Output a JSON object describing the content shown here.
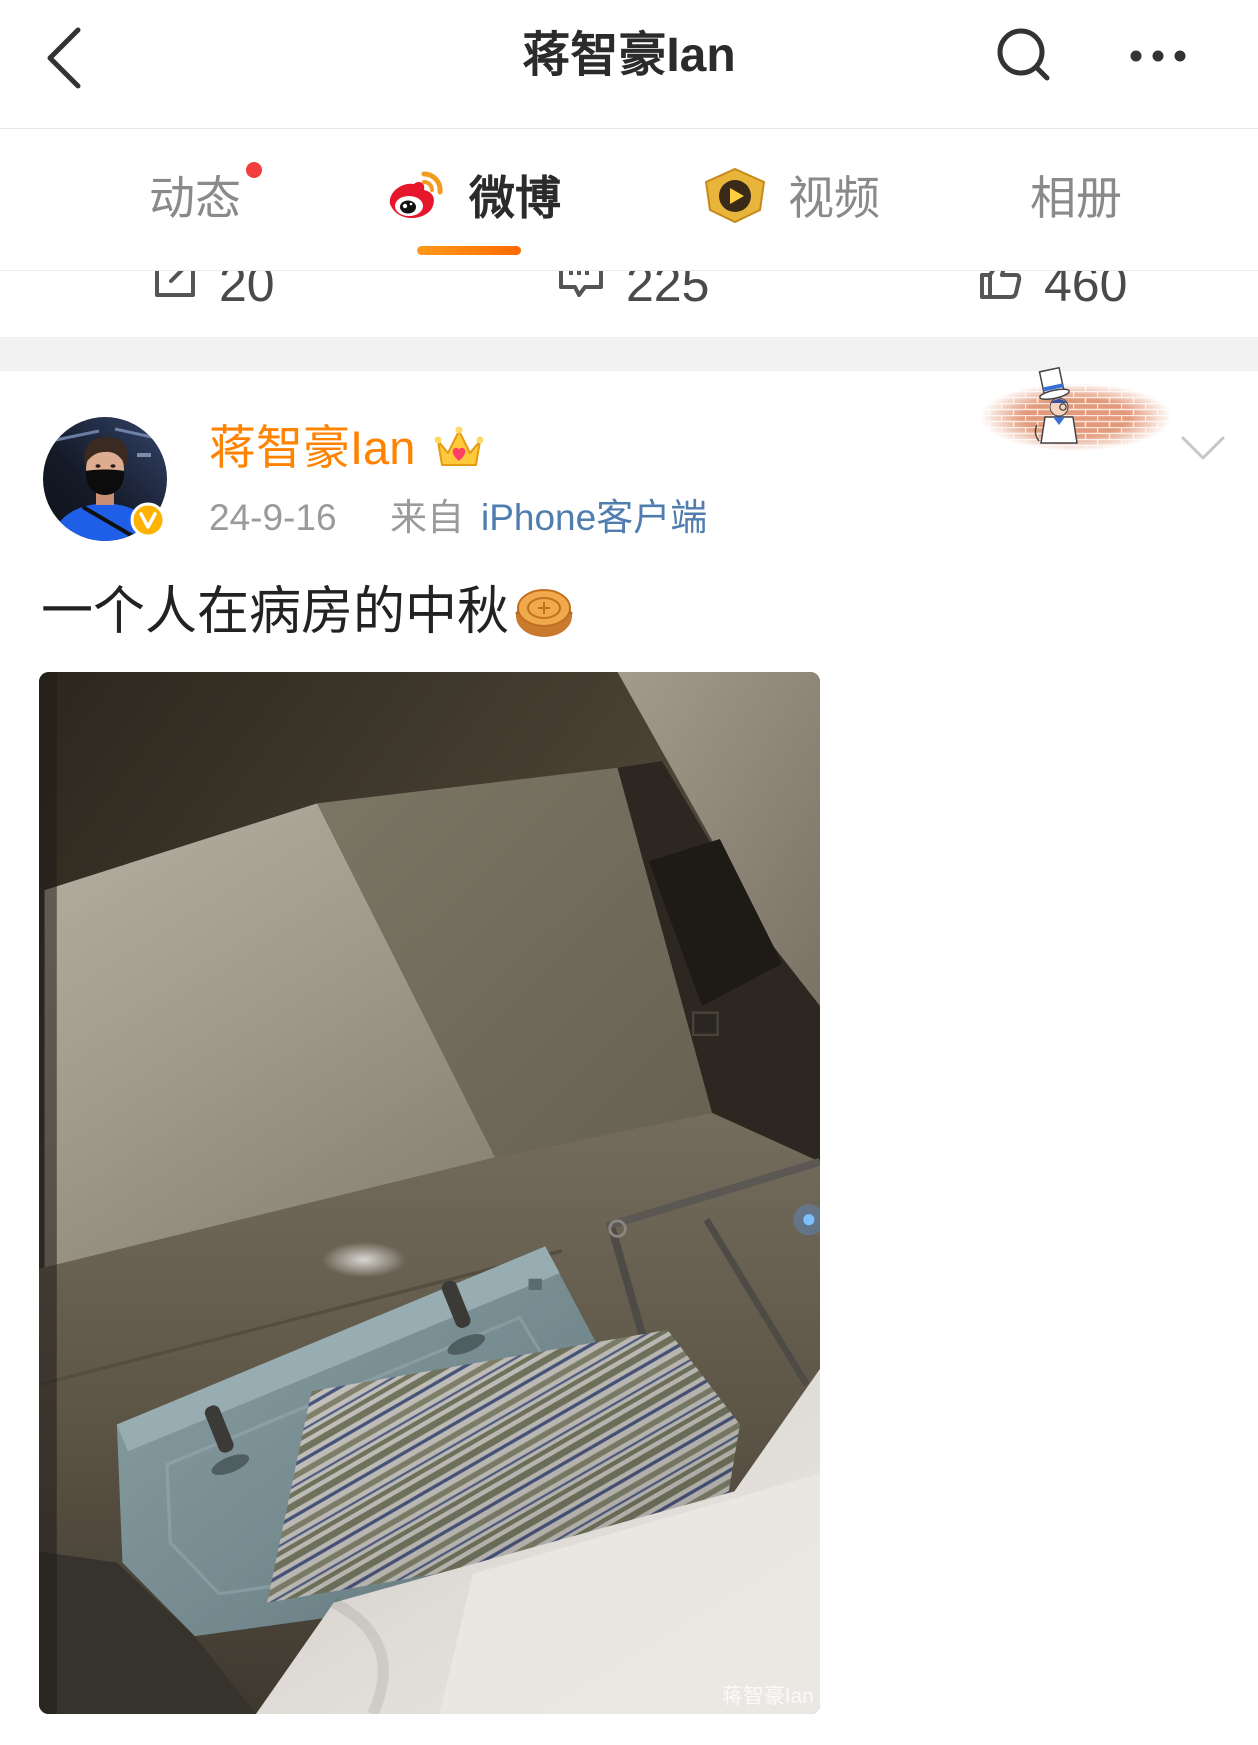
{
  "header": {
    "title": "蒋智豪Ian",
    "back_icon": "chevron-left-icon",
    "search_icon": "search-icon",
    "more_icon": "more-dots-icon"
  },
  "tabs": [
    {
      "label": "动态",
      "active": false,
      "has_notification_dot": true
    },
    {
      "label": "微博",
      "active": true,
      "icon": "weibo-logo-icon"
    },
    {
      "label": "视频",
      "active": false,
      "icon": "video-play-badge-icon"
    },
    {
      "label": "相册",
      "active": false
    }
  ],
  "stats": [
    {
      "icon": "repost-icon",
      "value": "20"
    },
    {
      "icon": "comment-icon",
      "value": "225"
    },
    {
      "icon": "like-icon",
      "value": "460"
    }
  ],
  "post": {
    "author": "蒋智豪Ian",
    "author_badge_icon": "crown-icon",
    "verified": true,
    "date": "24-9-16",
    "source_prefix": "来自",
    "source": "iPhone客户端",
    "text": "一个人在病房的中秋",
    "text_emoji_icon": "mooncake-icon",
    "image_watermark": "蒋智豪Ian",
    "decoration_icon": "card-decoration-sticker",
    "menu_icon": "chevron-down-icon"
  },
  "colors": {
    "accent": "#ff8200",
    "username": "#ff8200",
    "link": "#507daf",
    "notification_dot": "#f33e3e",
    "verified_badge": "#ffb300"
  }
}
